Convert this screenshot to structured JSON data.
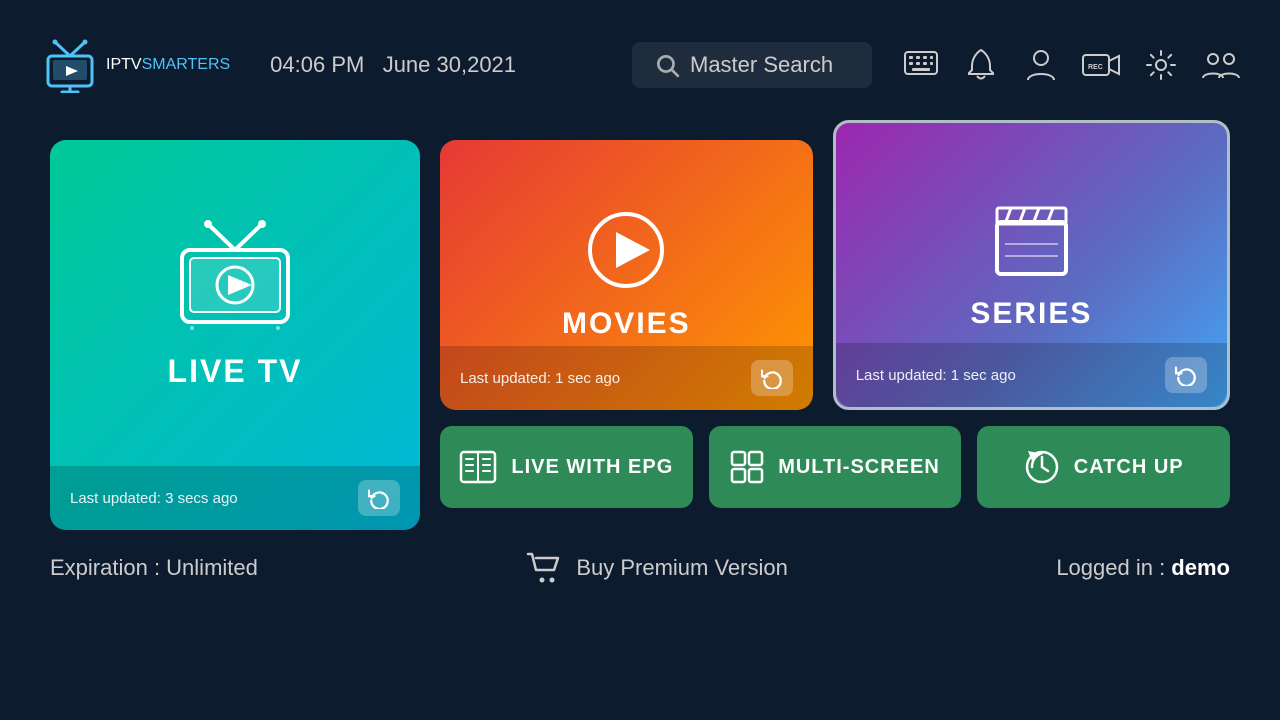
{
  "header": {
    "logo_iptv": "IPTV",
    "logo_smarters": "SMARTERS",
    "time": "04:06 PM",
    "date": "June 30,2021",
    "search_label": "Master Search",
    "icons": {
      "keyboard": "⌨",
      "bell": "🔔",
      "person": "👤",
      "rec": "⏺",
      "settings": "⚙",
      "users": "👥"
    }
  },
  "cards": {
    "live_tv": {
      "title": "LIVE TV",
      "last_updated": "Last updated: 3 secs ago"
    },
    "movies": {
      "title": "MOVIES",
      "last_updated": "Last updated: 1 sec ago"
    },
    "series": {
      "title": "SERIES",
      "last_updated": "Last updated: 1 sec ago"
    }
  },
  "buttons": {
    "live_epg": "LIVE WITH EPG",
    "multi_screen": "MULTI-SCREEN",
    "catch_up": "CATCH UP"
  },
  "footer": {
    "expiration": "Expiration : Unlimited",
    "buy_premium": "Buy Premium Version",
    "logged_in_label": "Logged in : ",
    "logged_in_user": "demo"
  }
}
